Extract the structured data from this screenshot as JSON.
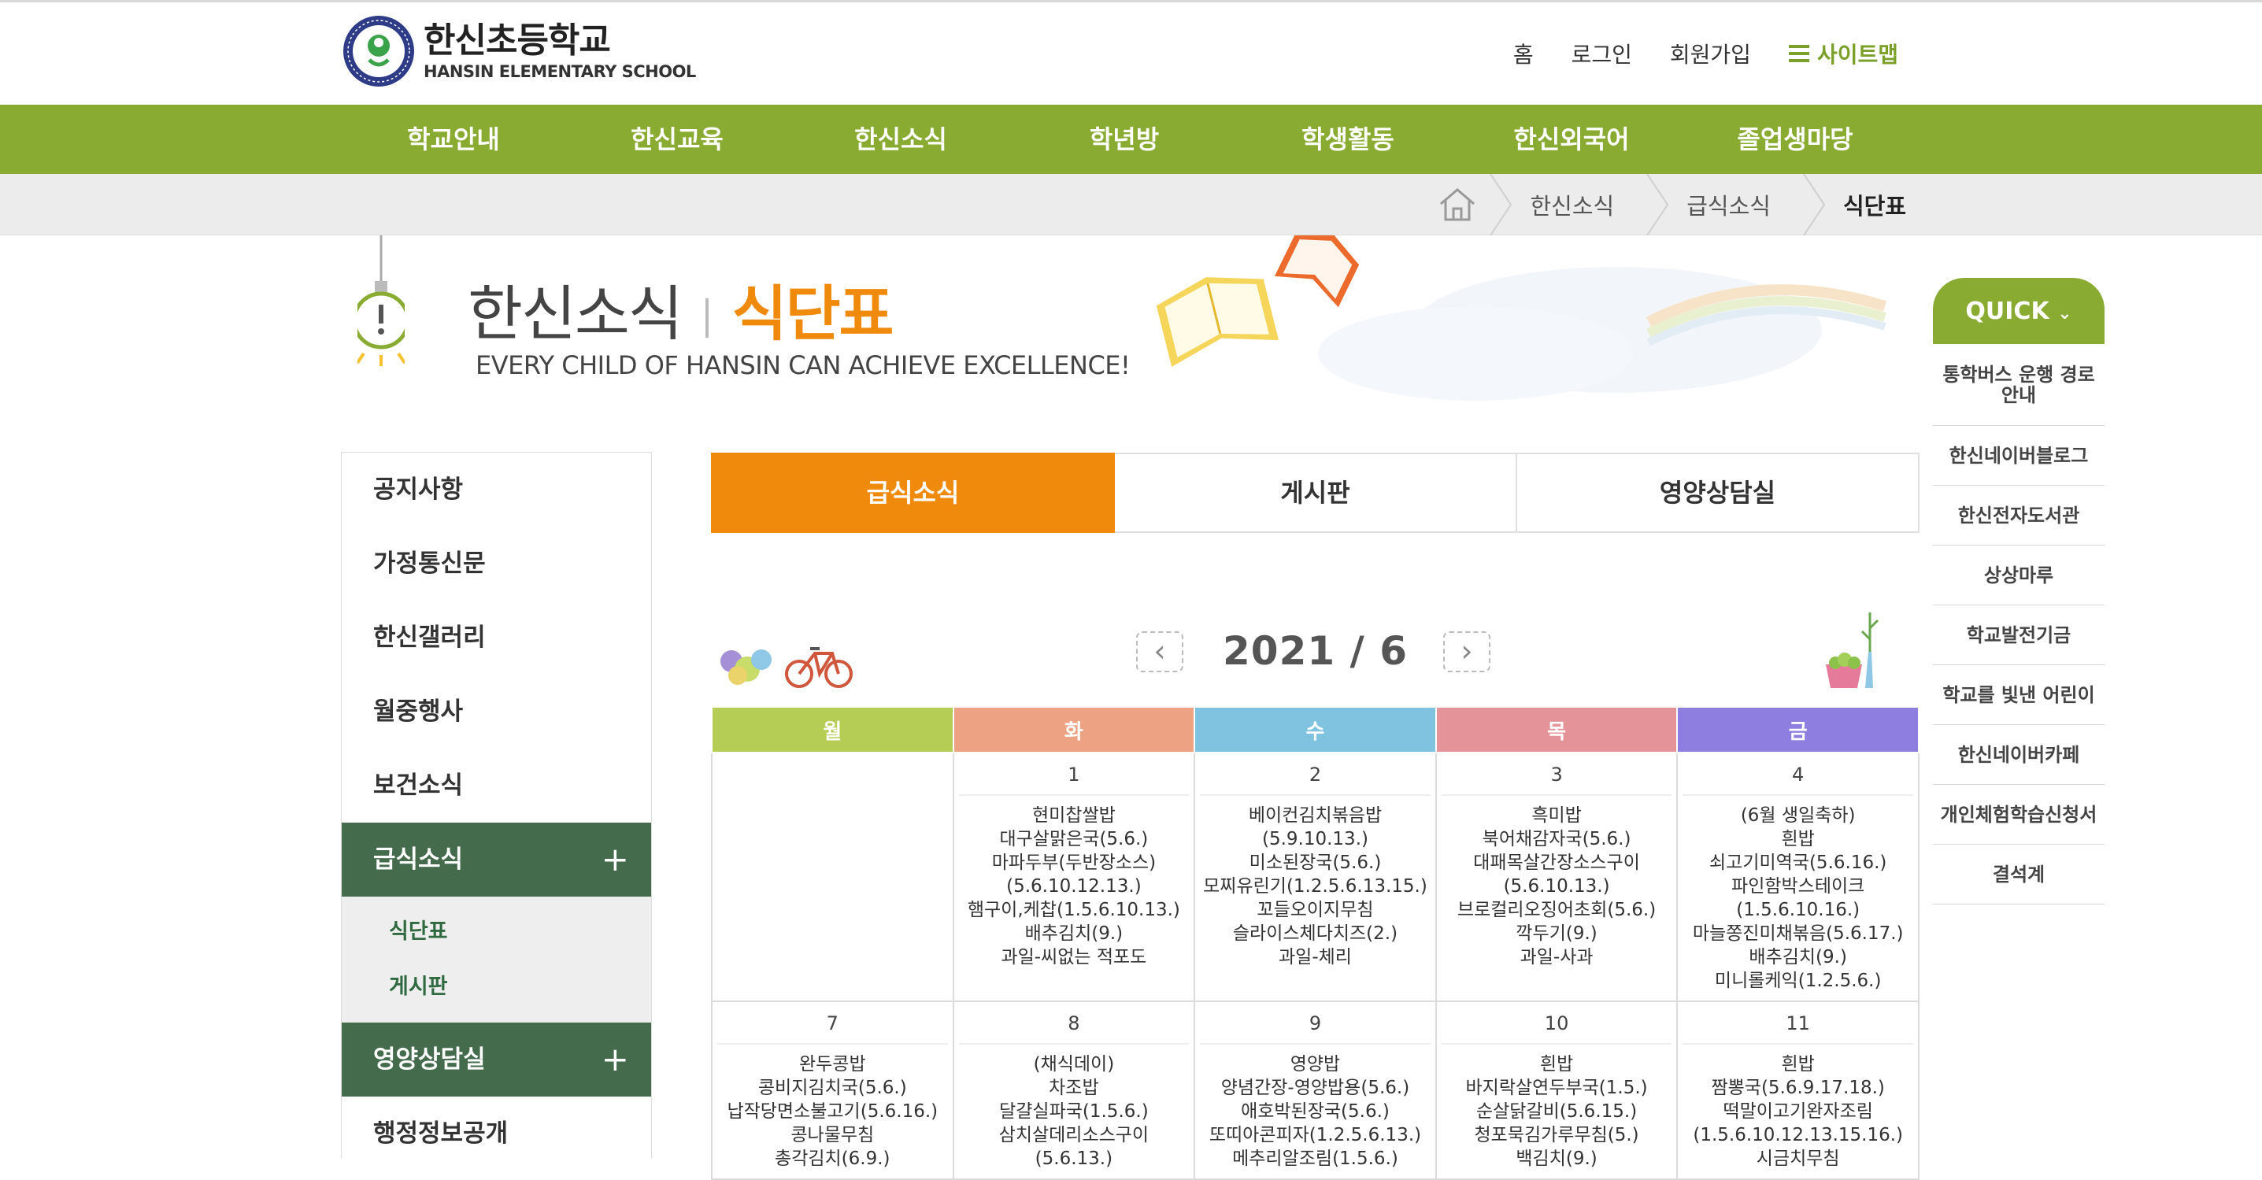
{
  "header": {
    "logo_ko": "한신초등학교",
    "logo_en": "HANSIN ELEMENTARY SCHOOL",
    "util": {
      "home": "홈",
      "login": "로그인",
      "join": "회원가입",
      "sitemap": "사이트맵"
    }
  },
  "gnb": [
    "학교안내",
    "한신교육",
    "한신소식",
    "학년방",
    "학생활동",
    "한신외국어",
    "졸업생마당"
  ],
  "breadcrumb": [
    "한신소식",
    "급식소식",
    "식단표"
  ],
  "visual": {
    "section": "한신소식",
    "page": "식단표",
    "slogan": "EVERY CHILD OF HANSIN CAN ACHIEVE EXCELLENCE!"
  },
  "quick": {
    "title": "QUICK",
    "items": [
      "통학버스 운행 경로 안내",
      "한신네이버블로그",
      "한신전자도서관",
      "상상마루",
      "학교발전기금",
      "학교를 빛낸 어린이",
      "한신네이버카페",
      "개인체험학습신청서",
      "결석계"
    ]
  },
  "lnb": {
    "items": [
      "공지사항",
      "가정통신문",
      "한신갤러리",
      "월중행사",
      "보건소식"
    ],
    "active": "급식소식",
    "sub": [
      "식단표",
      "게시판"
    ],
    "active2": "영양상담실",
    "last": "행정정보공개"
  },
  "tabs": [
    "급식소식",
    "게시판",
    "영양상담실"
  ],
  "calendar": {
    "month": "2021 / 6",
    "prev": "‹",
    "next": "›",
    "weekdays": [
      "월",
      "화",
      "수",
      "목",
      "금"
    ],
    "weekday_colors": [
      "#b5cc55",
      "#eda383",
      "#7fc3e0",
      "#e49499",
      "#8e7ee0"
    ],
    "week1": [
      {
        "day": "",
        "menu": ""
      },
      {
        "day": "1",
        "menu": "현미찹쌀밥\n대구살맑은국(5.6.)\n마파두부(두반장소스)\n(5.6.10.12.13.)\n햄구이,케찹(1.5.6.10.13.)\n배추김치(9.)\n과일-씨없는 적포도"
      },
      {
        "day": "2",
        "menu": "베이컨김치볶음밥\n(5.9.10.13.)\n미소된장국(5.6.)\n모찌유린기(1.2.5.6.13.15.)\n꼬들오이지무침\n슬라이스체다치즈(2.)\n과일-체리"
      },
      {
        "day": "3",
        "menu": "흑미밥\n북어채감자국(5.6.)\n대패목살간장소스구이\n(5.6.10.13.)\n브로컬리오징어초회(5.6.)\n깍두기(9.)\n과일-사과"
      },
      {
        "day": "4",
        "menu": "(6월 생일축하)\n흰밥\n쇠고기미역국(5.6.16.)\n파인함박스테이크\n(1.5.6.10.16.)\n마늘쫑진미채볶음(5.6.17.)\n배추김치(9.)\n미니롤케익(1.2.5.6.)"
      }
    ],
    "week2": [
      {
        "day": "7",
        "menu": "완두콩밥\n콩비지김치국(5.6.)\n납작당면소불고기(5.6.16.)\n콩나물무침\n총각김치(6.9.)"
      },
      {
        "day": "8",
        "menu": "(채식데이)\n차조밥\n달걀실파국(1.5.6.)\n삼치살데리소스구이\n(5.6.13.)"
      },
      {
        "day": "9",
        "menu": "영양밥\n양념간장-영양밥용(5.6.)\n애호박된장국(5.6.)\n또띠아콘피자(1.2.5.6.13.)\n메추리알조림(1.5.6.)"
      },
      {
        "day": "10",
        "menu": "흰밥\n바지락살연두부국(1.5.)\n순살닭갈비(5.6.15.)\n청포묵김가루무침(5.)\n백김치(9.)"
      },
      {
        "day": "11",
        "menu": "흰밥\n짬뽕국(5.6.9.17.18.)\n떡말이고기완자조림\n(1.5.6.10.12.13.15.16.)\n시금치무침"
      }
    ]
  }
}
